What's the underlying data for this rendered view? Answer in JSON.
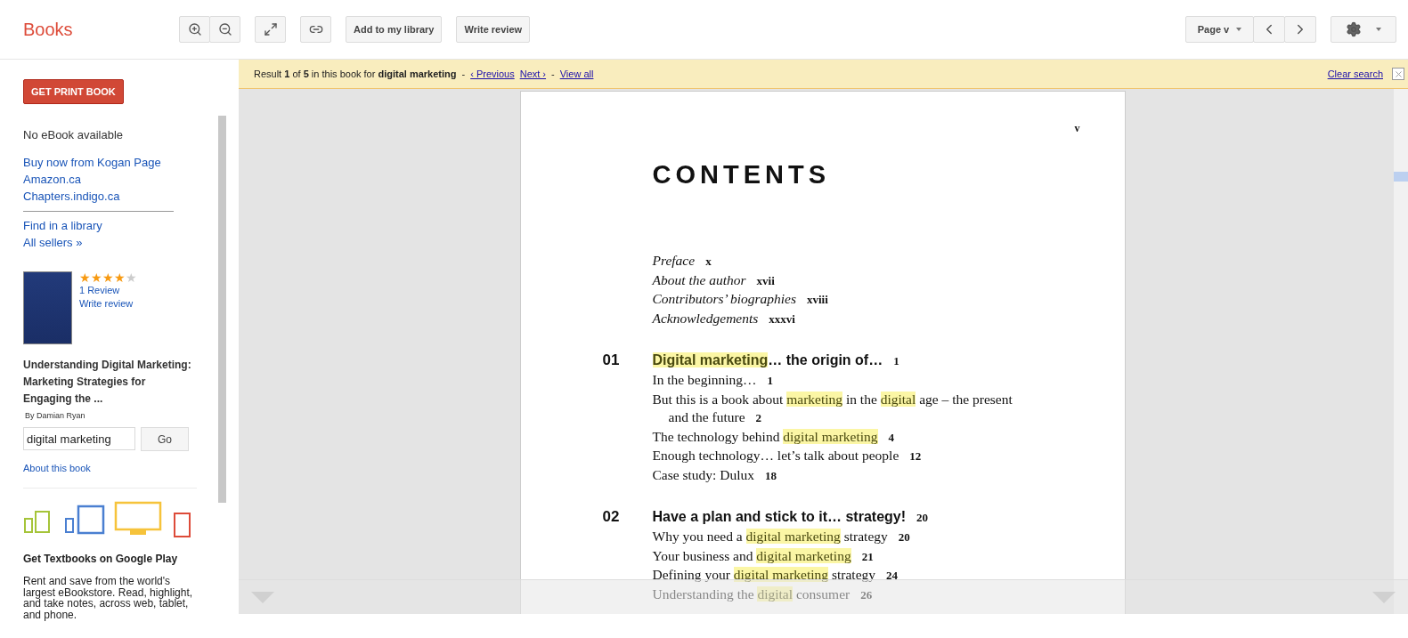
{
  "header": {
    "logo": "Books",
    "toolbar": [
      {
        "kind": "icon"
      },
      {
        "kind": "icon"
      },
      {
        "kind": "icon"
      },
      {
        "kind": "icon"
      },
      {
        "kind": "text",
        "label": "Add to my library"
      },
      {
        "kind": "text",
        "label": "Write review"
      }
    ],
    "page_menu": "Page v"
  },
  "sidebar": {
    "print_button": "GET PRINT BOOK",
    "ebook_status": "No eBook available",
    "buy_links": [
      "Buy now from Kogan Page",
      "Amazon.ca",
      "Chapters.indigo.ca"
    ],
    "more_links": [
      "Find in a library",
      "All sellers »"
    ],
    "book": {
      "stars": 4,
      "reviews": "1 Review",
      "write_review": "Write review",
      "title": "Understanding Digital Marketing: Marketing Strategies for Engaging the ...",
      "author": "By Damian Ryan"
    },
    "search": {
      "value": "digital marketing",
      "button": "Go"
    },
    "about": "About this book",
    "promo": {
      "title": "Get Textbooks on Google Play",
      "text": "Rent and save from the world's largest eBookstore. Read, highlight, and take notes, across web, tablet, and phone."
    }
  },
  "search_bar": {
    "result": "Result **1** of **5** in this book for **digital marketing**",
    "links": [
      "‹ Previous",
      "Next ›",
      "View all"
    ],
    "separators": [
      "-",
      "-"
    ],
    "clear": "Clear search"
  },
  "page": {
    "number": "v",
    "heading": "CONTENTS",
    "entries": [
      {
        "kind": "front",
        "segments": [
          {
            "text": "Preface",
            "highlight": false
          }
        ],
        "page": "x"
      },
      {
        "kind": "front",
        "segments": [
          {
            "text": "About the author",
            "highlight": false
          }
        ],
        "page": "xvii"
      },
      {
        "kind": "front",
        "segments": [
          {
            "text": "Contributors’ biographies",
            "highlight": false
          }
        ],
        "page": "xviii"
      },
      {
        "kind": "front",
        "segments": [
          {
            "text": "Acknowledgements",
            "highlight": false
          }
        ],
        "page": "xxxvi"
      },
      {
        "kind": "chapter",
        "number": "01",
        "segments": [
          {
            "text": "Digital marketing",
            "highlight": true
          },
          {
            "text": "… the origin of…",
            "highlight": false
          }
        ],
        "page": "1"
      },
      {
        "kind": "section",
        "segments": [
          {
            "text": "In the beginning…",
            "highlight": false
          }
        ],
        "page": "1"
      },
      {
        "kind": "section",
        "segments": [
          {
            "text": "But this is a book about ",
            "highlight": false
          },
          {
            "text": "marketing",
            "highlight": true
          },
          {
            "text": " in the ",
            "highlight": false
          },
          {
            "text": "digital",
            "highlight": true
          },
          {
            "text": " age – the present",
            "highlight": false
          }
        ],
        "continuation": "and the future",
        "page": "2"
      },
      {
        "kind": "section",
        "segments": [
          {
            "text": "The technology behind ",
            "highlight": false
          },
          {
            "text": "digital marketing",
            "highlight": true
          }
        ],
        "page": "4"
      },
      {
        "kind": "section",
        "segments": [
          {
            "text": "Enough technology… let’s talk about people",
            "highlight": false
          }
        ],
        "page": "12"
      },
      {
        "kind": "section",
        "segments": [
          {
            "text": "Case study: Dulux",
            "highlight": false
          }
        ],
        "page": "18"
      },
      {
        "kind": "chapter",
        "number": "02",
        "segments": [
          {
            "text": "Have a plan and stick to it… strategy!",
            "highlight": false
          }
        ],
        "page": "20"
      },
      {
        "kind": "section",
        "segments": [
          {
            "text": "Why you need a ",
            "highlight": false
          },
          {
            "text": "digital marketing",
            "highlight": true
          },
          {
            "text": " strategy",
            "highlight": false
          }
        ],
        "page": "20"
      },
      {
        "kind": "section",
        "segments": [
          {
            "text": "Your business and ",
            "highlight": false
          },
          {
            "text": "digital marketing",
            "highlight": true
          }
        ],
        "page": "21"
      },
      {
        "kind": "section",
        "segments": [
          {
            "text": "Defining your ",
            "highlight": false
          },
          {
            "text": "digital marketing",
            "highlight": true
          },
          {
            "text": " strategy",
            "highlight": false
          }
        ],
        "page": "24"
      },
      {
        "kind": "section",
        "segments": [
          {
            "text": "Understanding the ",
            "highlight": false
          },
          {
            "text": "digital",
            "highlight": true
          },
          {
            "text": " consumer",
            "highlight": false
          }
        ],
        "page": "26"
      }
    ]
  }
}
